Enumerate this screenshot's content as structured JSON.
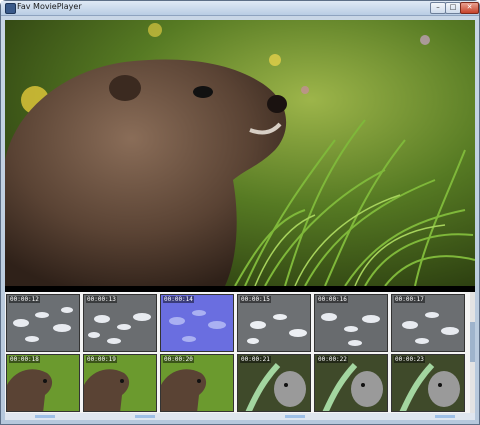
{
  "window": {
    "title": "Fav MoviePlayer",
    "min_glyph": "–",
    "max_glyph": "□",
    "close_glyph": "✕"
  },
  "thumbnails": [
    {
      "time": "00:00:12",
      "scene": "geese"
    },
    {
      "time": "00:00:13",
      "scene": "geese"
    },
    {
      "time": "00:00:14",
      "scene": "geese-selected"
    },
    {
      "time": "00:00:15",
      "scene": "geese"
    },
    {
      "time": "00:00:16",
      "scene": "geese"
    },
    {
      "time": "00:00:17",
      "scene": "geese"
    },
    {
      "time": "00:00:18",
      "scene": "marmot"
    },
    {
      "time": "00:00:19",
      "scene": "marmot"
    },
    {
      "time": "00:00:20",
      "scene": "marmot"
    },
    {
      "time": "00:00:21",
      "scene": "koala"
    },
    {
      "time": "00:00:22",
      "scene": "koala"
    },
    {
      "time": "00:00:23",
      "scene": "koala"
    }
  ],
  "colors": {
    "selected_tint": "#6a6ee0",
    "grass": "#6b9a2e",
    "fur": "#5a4334"
  }
}
